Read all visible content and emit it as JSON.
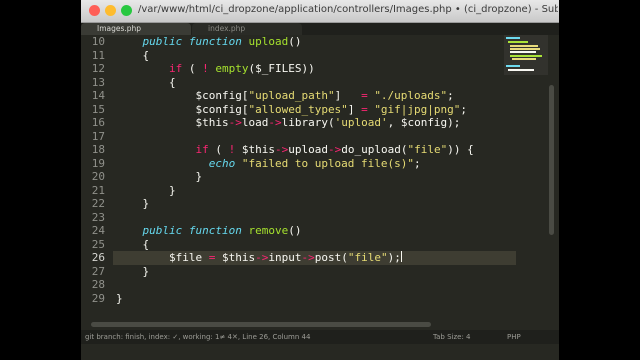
{
  "window": {
    "title": "/var/www/html/ci_dropzone/application/controllers/Images.php • (ci_dropzone) - Sublime Text (U",
    "traffic_lights": {
      "close": "#ff5f57",
      "minimize": "#febc2e",
      "zoom": "#28c840"
    }
  },
  "tabs": [
    {
      "label": "Images.php",
      "active": true
    },
    {
      "label": "index.php",
      "active": false
    }
  ],
  "editor": {
    "line_numbers": [
      "10",
      "11",
      "12",
      "13",
      "14",
      "15",
      "16",
      "17",
      "18",
      "19",
      "20",
      "21",
      "22",
      "23",
      "24",
      "25",
      "26",
      "27",
      "28",
      "29"
    ],
    "current_line": "26",
    "code": {
      "l10_kw1": "public",
      "l10_kw2": "function",
      "l10_name": "upload",
      "l10_rest": "()",
      "l11": "{",
      "l12_if": "if",
      "l12_a": " ( ",
      "l12_not": "!",
      "l12_sp": " ",
      "l12_fn": "empty",
      "l12_b": "($_FILES))",
      "l13": "{",
      "l14_var": "$config[",
      "l14_key": "\"upload_path\"",
      "l14_mid": "]   ",
      "l14_eq": "=",
      "l14_sp": " ",
      "l14_val": "\"./uploads\"",
      "l14_end": ";",
      "l15_var": "$config[",
      "l15_key": "\"allowed_types\"",
      "l15_mid": "] ",
      "l15_eq": "=",
      "l15_sp": " ",
      "l15_val": "\"gif|jpg|png\"",
      "l15_end": ";",
      "l16_this": "$this",
      "l16_arrow1": "->",
      "l16_load": "load",
      "l16_arrow2": "->",
      "l16_lib": "library(",
      "l16_str": "'upload'",
      "l16_end": ", $config);",
      "l18_if": "if",
      "l18_a": " ( ",
      "l18_not": "!",
      "l18_this": " $this",
      "l18_arrow1": "->",
      "l18_upload": "upload",
      "l18_arrow2": "->",
      "l18_fn": "do_upload(",
      "l18_str": "\"file\"",
      "l18_end": ")) {",
      "l19_echo": "echo",
      "l19_sp": " ",
      "l19_str": "\"failed to upload file(s)\"",
      "l19_end": ";",
      "l20": "}",
      "l21": "}",
      "l22": "}",
      "l24_kw1": "public",
      "l24_kw2": "function",
      "l24_name": "remove",
      "l24_rest": "()",
      "l25": "{",
      "l26_var": "$file ",
      "l26_eq": "=",
      "l26_this": " $this",
      "l26_arrow1": "->",
      "l26_input": "input",
      "l26_arrow2": "->",
      "l26_fn": "post(",
      "l26_str": "\"file\"",
      "l26_end": ");",
      "l27": "}",
      "l29": "}"
    }
  },
  "statusbar": {
    "left": "git branch: finish, index: ✓, working: 1≠ 4✕, Line 26, Column 44",
    "tab_size": "Tab Size: 4",
    "syntax": "PHP"
  },
  "colors": {
    "background": "#272822",
    "keyword": "#66d9ef",
    "control": "#f92672",
    "function": "#a6e22e",
    "string": "#e6db74",
    "text": "#f8f8f2"
  }
}
